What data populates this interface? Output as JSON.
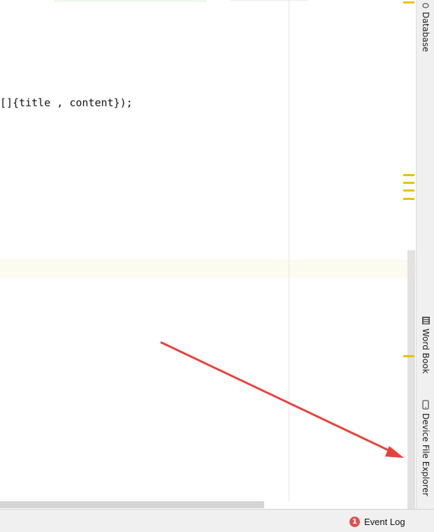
{
  "editor": {
    "code_line": "[]{title , content});"
  },
  "right_toolbar": {
    "tabs": [
      {
        "label": "Database",
        "icon": "database-icon"
      },
      {
        "label": "Word Book",
        "icon": "book-icon"
      },
      {
        "label": "Device File Explorer",
        "icon": "device-icon"
      }
    ]
  },
  "status_bar": {
    "event_log_count": "1",
    "event_log_label": "Event Log"
  },
  "colors": {
    "marker": "#e6c300",
    "annotation_arrow": "#e8413c",
    "badge": "#d9534f"
  }
}
